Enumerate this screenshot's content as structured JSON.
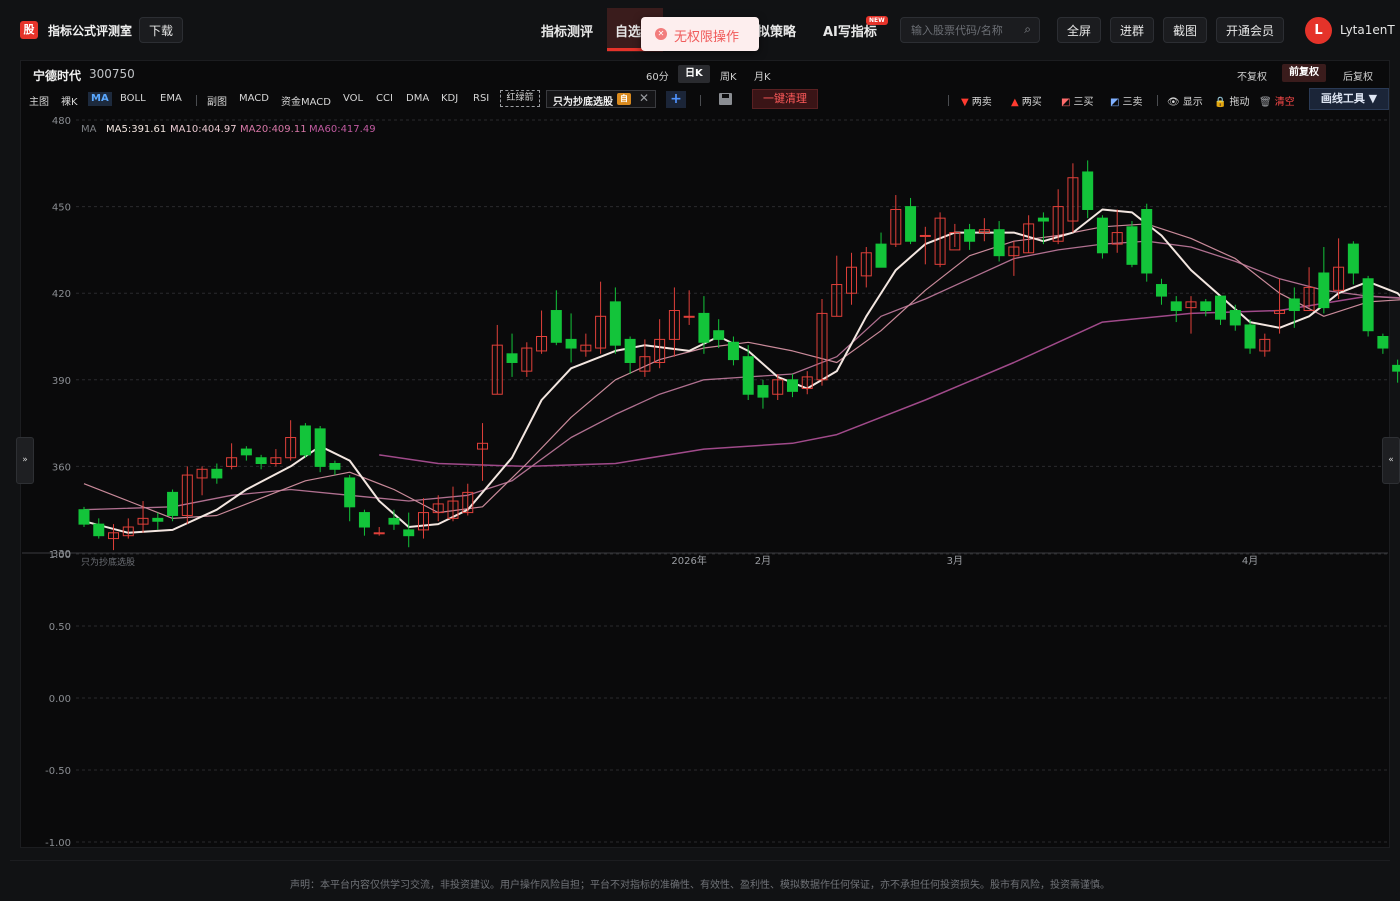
{
  "app": {
    "logo": "股",
    "title": "指标公式评测室",
    "download": "下载"
  },
  "nav": {
    "items": [
      "指标测评",
      "自选",
      "模拟策略",
      "AI写指标"
    ],
    "visible_labels": [
      "指标测评",
      "自选",
      "拟策略",
      "AI写指标"
    ],
    "new_badge": "NEW",
    "active": "自选"
  },
  "toast": {
    "text": "无权限操作"
  },
  "search": {
    "placeholder": "输入股票代码/名称"
  },
  "header_buttons": {
    "fullscreen": "全屏",
    "join_group": "进群",
    "screenshot": "截图",
    "vip": "开通会员"
  },
  "user": {
    "avatar_letter": "L",
    "name": "Lyta1enT"
  },
  "stock": {
    "name": "宁德时代",
    "code": "300750"
  },
  "periods": {
    "items": [
      "60分",
      "日K",
      "周K",
      "月K"
    ],
    "active": "日K"
  },
  "adjust": {
    "items": [
      "不复权",
      "前复权",
      "后复权"
    ],
    "active": "前复权"
  },
  "indicators": {
    "main_label": "主图",
    "main": [
      "裸K",
      "MA",
      "BOLL",
      "EMA"
    ],
    "main_active": "MA",
    "sub_label": "副图",
    "sub": [
      "MACD",
      "资金MACD",
      "VOL",
      "CCI",
      "DMA",
      "KDJ",
      "RSI"
    ],
    "custom_tag": "红绿箭",
    "formula_tag": "只为抄底选股",
    "formula_badge": "自"
  },
  "tools": {
    "clear_all": "一键清理",
    "two_sell": "两卖",
    "two_buy": "两买",
    "three_buy": "三买",
    "three_sell": "三卖",
    "show": "显示",
    "drag": "拖动",
    "clear": "清空",
    "draw_tools": "画线工具 ▼"
  },
  "ma_legend": {
    "prefix": "MA",
    "ma5": "MA5:391.61",
    "ma10": "MA10:404.97",
    "ma20": "MA20:409.11",
    "ma60": "MA60:417.49"
  },
  "colors": {
    "up": "#e0403a",
    "down": "#13c43a",
    "ma5": "#f3e6e0",
    "ma10": "#c98a9a",
    "ma20": "#b07090",
    "ma60": "#a04a8a",
    "accent_red": "#e5332a",
    "accent_blue": "#4f93ff"
  },
  "sub_panel": {
    "title": "只为抄底选股"
  },
  "side_tabs": {
    "left": "»",
    "right": "«"
  },
  "disclaimer": "声明：本平台内容仅供学习交流，非投资建议。用户操作风险自担；平台不对指标的准确性、有效性、盈利性、模拟数据作任何保证，亦不承担任何投资损失。股市有风险，投资需谨慎。",
  "chart_data": {
    "type": "candlestick",
    "price_axis": {
      "ylim": [
        330,
        480
      ],
      "ticks": [
        480,
        450,
        420,
        390,
        360,
        330
      ]
    },
    "sub_axis": {
      "ylim": [
        -1.0,
        1.0
      ],
      "ticks": [
        "1.00",
        "0.50",
        "0.00",
        "-0.50",
        "-1.00"
      ]
    },
    "x_labels": [
      "2026年",
      "2月",
      "3月",
      "4月"
    ],
    "x_label_index": [
      41,
      46,
      59,
      79
    ],
    "candles": [
      [
        345,
        340,
        346,
        339
      ],
      [
        340,
        336,
        342,
        335
      ],
      [
        335,
        337,
        340,
        331
      ],
      [
        336,
        339,
        342,
        335
      ],
      [
        340,
        342,
        348,
        337
      ],
      [
        342,
        341,
        344,
        338
      ],
      [
        351,
        343,
        352,
        341
      ],
      [
        343,
        357,
        360,
        340
      ],
      [
        356,
        359,
        360,
        350
      ],
      [
        359,
        356,
        361,
        354
      ],
      [
        360,
        363,
        368,
        359
      ],
      [
        366,
        364,
        367,
        362
      ],
      [
        363,
        361,
        364,
        359
      ],
      [
        361,
        363,
        366,
        360
      ],
      [
        363,
        370,
        376,
        362
      ],
      [
        374,
        364,
        375,
        363
      ],
      [
        373,
        360,
        374,
        358
      ],
      [
        361,
        359,
        362,
        357
      ],
      [
        356,
        346,
        357,
        341
      ],
      [
        344,
        339,
        345,
        336
      ],
      [
        337,
        337,
        339,
        336
      ],
      [
        342,
        340,
        345,
        338
      ],
      [
        338,
        336,
        344,
        332
      ],
      [
        338,
        344,
        349,
        335
      ],
      [
        344,
        347,
        350,
        341
      ],
      [
        342,
        348,
        353,
        341
      ],
      [
        344,
        351,
        354,
        343
      ],
      [
        366,
        368,
        375,
        355
      ],
      [
        385,
        402,
        409,
        385
      ],
      [
        399,
        396,
        406,
        391
      ],
      [
        393,
        401,
        403,
        391
      ],
      [
        400,
        405,
        414,
        399
      ],
      [
        414,
        403,
        421,
        402
      ],
      [
        404,
        401,
        413,
        396
      ],
      [
        400,
        402,
        406,
        398
      ],
      [
        401,
        412,
        424,
        399
      ],
      [
        417,
        402,
        422,
        399
      ],
      [
        404,
        396,
        405,
        392
      ],
      [
        393,
        398,
        404,
        391
      ],
      [
        396,
        404,
        411,
        394
      ],
      [
        404,
        414,
        422,
        398
      ],
      [
        412,
        412,
        421,
        409
      ],
      [
        413,
        403,
        419,
        399
      ],
      [
        407,
        404,
        411,
        401
      ],
      [
        403,
        397,
        405,
        395
      ],
      [
        398,
        385,
        402,
        383
      ],
      [
        388,
        384,
        390,
        380
      ],
      [
        385,
        390,
        392,
        383
      ],
      [
        390,
        386,
        392,
        384
      ],
      [
        387,
        391,
        393,
        385
      ],
      [
        390,
        413,
        418,
        388
      ],
      [
        412,
        423,
        433,
        412
      ],
      [
        420,
        429,
        434,
        416
      ],
      [
        426,
        434,
        436,
        422
      ],
      [
        437,
        429,
        441,
        429
      ],
      [
        437,
        449,
        454,
        436
      ],
      [
        450,
        438,
        453,
        437
      ],
      [
        440,
        440,
        443,
        430
      ],
      [
        430,
        446,
        448,
        429
      ],
      [
        435,
        441,
        444,
        436
      ],
      [
        442,
        438,
        444,
        435
      ],
      [
        441,
        442,
        446,
        438
      ],
      [
        442,
        433,
        445,
        431
      ],
      [
        433,
        436,
        438,
        426
      ],
      [
        434,
        444,
        447,
        434
      ],
      [
        446,
        445,
        448,
        437
      ],
      [
        438,
        450,
        456,
        437
      ],
      [
        445,
        460,
        465,
        441
      ],
      [
        462,
        449,
        466,
        446
      ],
      [
        446,
        434,
        447,
        432
      ],
      [
        437,
        441,
        449,
        434
      ],
      [
        443,
        430,
        445,
        429
      ],
      [
        449,
        427,
        451,
        424
      ],
      [
        423,
        419,
        425,
        416
      ],
      [
        417,
        414,
        419,
        410
      ],
      [
        415,
        417,
        419,
        406
      ],
      [
        417,
        414,
        418,
        412
      ],
      [
        419,
        411,
        419,
        409
      ],
      [
        414,
        409,
        416,
        407
      ],
      [
        409,
        401,
        411,
        399
      ],
      [
        400,
        404,
        406,
        398
      ],
      [
        413,
        414,
        425,
        406
      ],
      [
        418,
        414,
        422,
        408
      ],
      [
        414,
        422,
        429,
        415
      ],
      [
        427,
        415,
        436,
        413
      ],
      [
        421,
        429,
        439,
        418
      ],
      [
        437,
        427,
        438,
        423
      ],
      [
        425,
        407,
        426,
        405
      ],
      [
        405,
        401,
        406,
        399
      ],
      [
        395,
        393,
        397,
        389
      ],
      [
        402,
        402,
        405,
        393
      ],
      [
        396,
        389,
        398,
        388
      ],
      [
        388,
        383,
        390,
        381
      ],
      [
        390,
        396,
        401,
        387
      ]
    ],
    "ma5": [
      [
        0,
        341
      ],
      [
        3,
        337
      ],
      [
        6,
        338
      ],
      [
        9,
        345
      ],
      [
        11,
        352
      ],
      [
        14,
        360
      ],
      [
        16,
        367
      ],
      [
        18,
        362
      ],
      [
        20,
        348
      ],
      [
        22,
        339
      ],
      [
        24,
        340
      ],
      [
        26,
        345
      ],
      [
        29,
        363
      ],
      [
        31,
        383
      ],
      [
        33,
        394
      ],
      [
        36,
        400
      ],
      [
        38,
        402
      ],
      [
        41,
        400
      ],
      [
        43,
        405
      ],
      [
        45,
        400
      ],
      [
        47,
        391
      ],
      [
        49,
        387
      ],
      [
        51,
        393
      ],
      [
        53,
        412
      ],
      [
        55,
        428
      ],
      [
        57,
        437
      ],
      [
        59,
        441
      ],
      [
        61,
        441
      ],
      [
        63,
        441
      ],
      [
        65,
        438
      ],
      [
        67,
        441
      ],
      [
        69,
        449
      ],
      [
        71,
        448
      ],
      [
        73,
        440
      ],
      [
        75,
        428
      ],
      [
        77,
        419
      ],
      [
        79,
        410
      ],
      [
        81,
        408
      ],
      [
        83,
        412
      ],
      [
        85,
        420
      ],
      [
        87,
        424
      ],
      [
        89,
        420
      ],
      [
        91,
        409
      ],
      [
        93,
        398
      ],
      [
        94,
        391
      ]
    ],
    "ma10": [
      [
        0,
        354
      ],
      [
        3,
        348
      ],
      [
        6,
        342
      ],
      [
        9,
        343
      ],
      [
        12,
        349
      ],
      [
        15,
        355
      ],
      [
        18,
        358
      ],
      [
        21,
        352
      ],
      [
        24,
        344
      ],
      [
        27,
        346
      ],
      [
        30,
        361
      ],
      [
        33,
        377
      ],
      [
        36,
        390
      ],
      [
        39,
        397
      ],
      [
        42,
        401
      ],
      [
        45,
        403
      ],
      [
        48,
        400
      ],
      [
        51,
        396
      ],
      [
        54,
        407
      ],
      [
        57,
        421
      ],
      [
        60,
        433
      ],
      [
        63,
        438
      ],
      [
        66,
        440
      ],
      [
        69,
        443
      ],
      [
        72,
        444
      ],
      [
        75,
        439
      ],
      [
        78,
        432
      ],
      [
        81,
        420
      ],
      [
        84,
        412
      ],
      [
        87,
        417
      ],
      [
        90,
        418
      ],
      [
        94,
        404
      ]
    ],
    "ma20": [
      [
        0,
        345
      ],
      [
        6,
        346
      ],
      [
        10,
        350
      ],
      [
        14,
        352
      ],
      [
        18,
        350
      ],
      [
        22,
        348
      ],
      [
        26,
        350
      ],
      [
        29,
        355
      ],
      [
        33,
        370
      ],
      [
        36,
        378
      ],
      [
        39,
        385
      ],
      [
        42,
        390
      ],
      [
        45,
        391
      ],
      [
        48,
        392
      ],
      [
        51,
        398
      ],
      [
        54,
        412
      ],
      [
        57,
        418
      ],
      [
        60,
        425
      ],
      [
        63,
        432
      ],
      [
        66,
        435
      ],
      [
        69,
        437
      ],
      [
        72,
        438
      ],
      [
        75,
        436
      ],
      [
        78,
        431
      ],
      [
        81,
        425
      ],
      [
        84,
        421
      ],
      [
        87,
        419
      ],
      [
        90,
        418
      ],
      [
        94,
        409
      ]
    ],
    "ma60": [
      [
        20,
        364
      ],
      [
        24,
        361
      ],
      [
        30,
        360
      ],
      [
        36,
        361
      ],
      [
        42,
        366
      ],
      [
        48,
        368
      ],
      [
        51,
        371
      ],
      [
        57,
        383
      ],
      [
        63,
        396
      ],
      [
        69,
        410
      ],
      [
        75,
        413
      ],
      [
        81,
        414
      ],
      [
        87,
        419
      ],
      [
        94,
        417
      ]
    ]
  }
}
